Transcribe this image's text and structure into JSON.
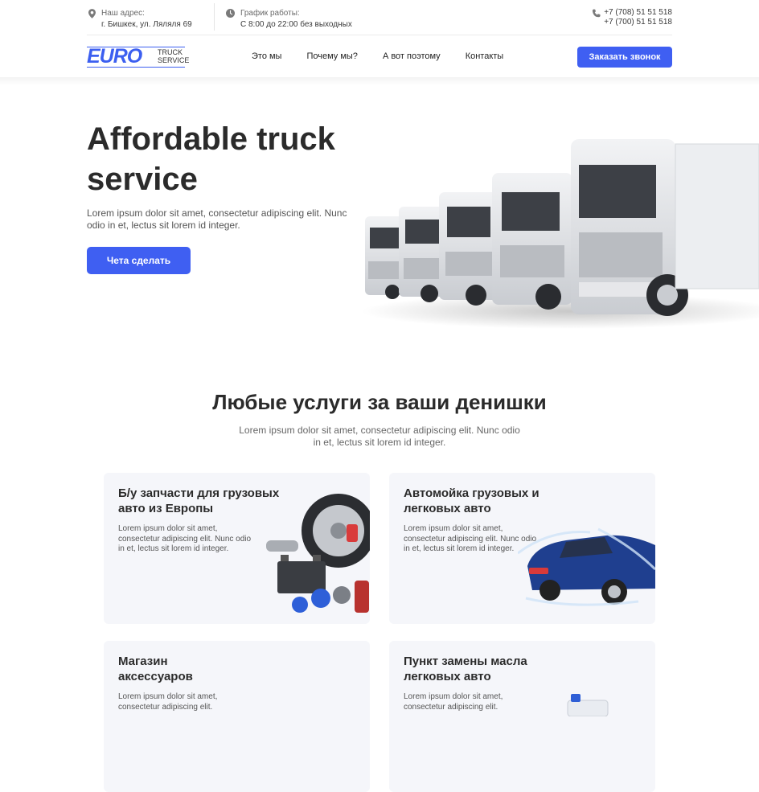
{
  "topbar": {
    "address_label": "Наш адрес:",
    "address_value": "г. Бишкек, ул. Ляляля 69",
    "hours_label": "График работы:",
    "hours_value": "С 8:00 до 22:00 без выходных",
    "phone_1": "+7 (708) 51 51 518",
    "phone_2": "+7 (700) 51 51 518"
  },
  "logo": {
    "main": "EURO",
    "sub_1": "TRUCK",
    "sub_2": "SERVICE"
  },
  "nav": {
    "items": [
      {
        "label": "Это мы"
      },
      {
        "label": "Почему мы?"
      },
      {
        "label": "А вот поэтому"
      },
      {
        "label": "Контакты"
      }
    ],
    "cta_label": "Заказать звонок"
  },
  "hero": {
    "title": "Affordable truck service",
    "text": "Lorem ipsum dolor sit amet, consectetur adipiscing elit. Nunc odio in et, lectus sit lorem id integer.",
    "button_label": "Чета сделать"
  },
  "services": {
    "title": "Любые услуги за ваши денишки",
    "subtitle": "Lorem ipsum dolor sit amet, consectetur adipiscing elit. Nunc odio in et, lectus sit lorem id integer.",
    "cards": [
      {
        "title": "Б/у запчасти для грузовых авто из Европы",
        "text": "Lorem ipsum dolor sit amet, consectetur adipiscing elit. Nunc odio in et, lectus sit lorem id integer."
      },
      {
        "title": "Автомойка грузовых и легковых авто",
        "text": "Lorem ipsum dolor sit amet, consectetur adipiscing elit. Nunc odio in et, lectus sit lorem id integer."
      },
      {
        "title": "Магазин аксессуаров",
        "text": "Lorem ipsum dolor sit amet, consectetur adipiscing elit."
      },
      {
        "title": "Пункт замены масла легковых авто",
        "text": "Lorem ipsum dolor sit amet, consectetur adipiscing elit."
      }
    ]
  },
  "colors": {
    "accent": "#3f5ff2",
    "card_bg": "#f5f6fa",
    "text_dark": "#2b2b2b"
  },
  "icons": {
    "address": "map-pin-icon",
    "hours": "clock-icon",
    "phone": "phone-icon"
  }
}
